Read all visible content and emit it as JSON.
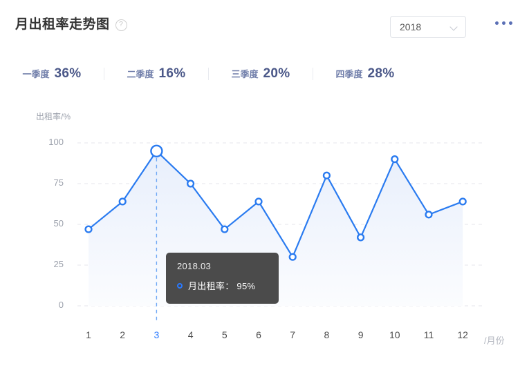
{
  "header": {
    "title": "月出租率走势图",
    "help_icon": "question-mark-circle-icon",
    "year_selected": "2018",
    "chevron_icon": "chevron-down-icon",
    "more_icon": "more-horizontal-icon"
  },
  "stats": [
    {
      "label": "一季度",
      "value": "36%"
    },
    {
      "label": "二季度",
      "value": "16%"
    },
    {
      "label": "三季度",
      "value": "20%"
    },
    {
      "label": "四季度",
      "value": "28%"
    }
  ],
  "tooltip": {
    "title": "2018.03",
    "series_label": "月出租率：",
    "value": "95%",
    "marker_icon": "circle-marker-icon"
  },
  "colors": {
    "accent": "#2979ff",
    "line": "#2a7bf0",
    "area_top": "#e8effc",
    "area_bottom": "#fbfcfe",
    "grid": "#e4e6eb",
    "indicator": "#6fa8f5",
    "tooltip_bg": "#4b4b4b",
    "stat_value": "#4a5788",
    "stat_label": "#6d7ba8"
  },
  "chart_data": {
    "type": "line",
    "title": "月出租率走势图",
    "xlabel": "/月份",
    "ylabel": "出租率/%",
    "categories": [
      "1",
      "2",
      "3",
      "4",
      "5",
      "6",
      "7",
      "8",
      "9",
      "10",
      "11",
      "12"
    ],
    "x_tick_labels": [
      "1",
      "2",
      "3",
      "4",
      "5",
      "6",
      "7",
      "8",
      "9",
      "10",
      "11",
      "12"
    ],
    "y_tick_labels": [
      "100",
      "75",
      "50",
      "25",
      "0"
    ],
    "y_ticks": [
      100,
      75,
      50,
      25,
      0
    ],
    "ylim": [
      0,
      100
    ],
    "grid": true,
    "legend": false,
    "area_fill": true,
    "highlighted_index": 2,
    "highlighted_label": "3",
    "series": [
      {
        "name": "月出租率",
        "values": [
          47,
          64,
          95,
          75,
          47,
          64,
          30,
          80,
          42,
          90,
          56,
          64
        ]
      }
    ]
  }
}
